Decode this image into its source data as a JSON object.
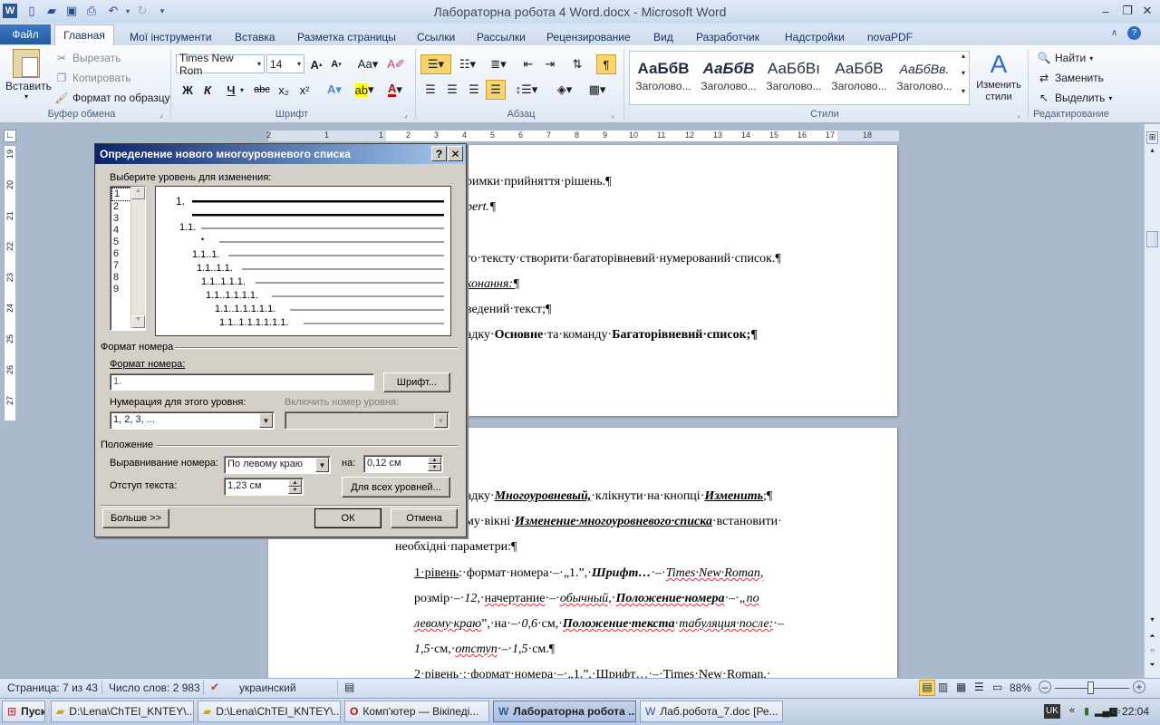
{
  "window": {
    "title": "Лабораторна робота 4 Word.docx  -  Microsoft Word"
  },
  "ribbon": {
    "tabs": [
      "Файл",
      "Главная",
      "Мої інструменти",
      "Вставка",
      "Разметка страницы",
      "Ссылки",
      "Рассылки",
      "Рецензирование",
      "Вид",
      "Разработчик",
      "Надстройки",
      "novaPDF"
    ],
    "clipboard": {
      "paste": "Вставить",
      "cut": "Вырезать",
      "copy": "Копировать",
      "format_painter": "Формат по образцу",
      "label": "Буфер обмена"
    },
    "font": {
      "name": "Times New Rom",
      "size": "14",
      "label": "Шрифт"
    },
    "paragraph": {
      "label": "Абзац"
    },
    "styles": {
      "label": "Стили",
      "items": [
        {
          "sample": "АаБбВ",
          "name": "Заголово..."
        },
        {
          "sample": "АаБбВ",
          "name": "Заголово..."
        },
        {
          "sample": "АаБбВı",
          "name": "Заголово..."
        },
        {
          "sample": "АаБбВ",
          "name": "Заголово..."
        },
        {
          "sample": "АаБбВв.",
          "name": "Заголово..."
        }
      ],
      "change": "Изменить стили"
    },
    "editing": {
      "find": "Найти",
      "replace": "Заменить",
      "select": "Выделить",
      "label": "Редактирование"
    }
  },
  "ruler": {
    "h_ticks": [
      "2",
      "1",
      "1",
      "2",
      "3",
      "4",
      "5",
      "6",
      "7",
      "8",
      "9",
      "10",
      "11",
      "12",
      "13",
      "14",
      "15",
      "16",
      "17",
      "18"
    ],
    "v_ticks": [
      "19",
      "20",
      "21",
      "22",
      "23",
      "24",
      "25",
      "26",
      "27"
    ]
  },
  "document": {
    "page1": [
      "римки·прийняття·рішень.¶",
      "pert.¶",
      "го·тексту·створити·багаторівневий·нумерований·список.¶",
      "конання:¶",
      "ведений·текст;¶"
    ],
    "page1_last": {
      "a": "адку·",
      "b": "Основне",
      "c": "·та·команду·",
      "d": "Багаторівневий·список;¶"
    },
    "page2": {
      "l1a": "адку·",
      "l1b": "Многоуровневый,",
      "l1c": "·клікнути·на·кнопці·",
      "l1d": "Изменить",
      "l1e": ";¶",
      "l2a": "му·вікні·",
      "l2b": "Изменение·многоуровневого·списка",
      "l2c": "·встановити·",
      "l3": "необхідні·параметри:¶",
      "l4a": "1·рівень",
      "l4b": ":·формат·номера·–·„1.”,·",
      "l4c": "Шрифт…",
      "l4d": "·–·",
      "l4e": "Times·New·Roman,",
      "l5a": "розмір·–·",
      "l5b": "12,",
      "l5c": "·",
      "l5d": "начертание",
      "l5e": "·–·",
      "l5f": "обычный,",
      "l5g": "·",
      "l5h": "Положение·номера",
      "l5i": "·–·",
      "l5j": "„по",
      "l6a": "левому·краю",
      "l6b": "”,·на·–·",
      "l6c": "0,6",
      "l6d": "·см,·",
      "l6e": "Положение·текста",
      "l6f": "·",
      "l6g": "табуляция·после:",
      "l6h": "·–",
      "l7a": "1,5",
      "l7b": "·см,·",
      "l7c": "отступ",
      "l7d": "·–·",
      "l7e": "1,5",
      "l7f": "·см.¶",
      "l8": "2·рівень·:·формат·номера·–·„1.”,·Шрифт…·–·Times·New·Roman,·"
    }
  },
  "dialog": {
    "title": "Определение нового многоуровневого списка",
    "help": "?",
    "close": "✕",
    "level_label": "Выберите уровень для изменения:",
    "levels": [
      "1",
      "2",
      "3",
      "4",
      "5",
      "6",
      "7",
      "8",
      "9"
    ],
    "preview": [
      "1.",
      "1.1.",
      "•",
      "1.1..1.",
      "1.1..1.1.",
      "1.1..1.1.1.",
      "1.1..1.1.1.1.",
      "1.1..1.1.1.1.1.",
      "1.1..1.1.1.1.1.1."
    ],
    "number_format_section": "Формат номера",
    "number_format_label": "Формат номера:",
    "number_format_value": "1.",
    "font_button": "Шрифт...",
    "numbering_style_label": "Нумерация для этого уровня:",
    "numbering_style_value": "1, 2, 3, ...",
    "include_level_label": "Включить номер уровня:",
    "position_section": "Положение",
    "alignment_label": "Выравнивание номера:",
    "alignment_value": "По левому краю",
    "at_label": "на:",
    "at_value": "0,12 см",
    "indent_label": "Отступ текста:",
    "indent_value": "1,23 см",
    "all_levels_button": "Для всех уровней...",
    "more_button": "Больше >>",
    "ok_button": "ОК",
    "cancel_button": "Отмена"
  },
  "status": {
    "page": "Страница: 7 из 43",
    "words": "Число слов: 2 983",
    "language": "украинский",
    "zoom": "88%"
  },
  "taskbar": {
    "start": "Пуск",
    "tasks": [
      "D:\\Lena\\ChTEI_KNTEY\\...",
      "D:\\Lena\\ChTEI_KNTEY\\...",
      "Комп'ютер — Вікіпеді...",
      "Лабораторна робота ...",
      "Лаб.робота_7.doc [Ре..."
    ],
    "lang": "UK",
    "time": "22:04"
  },
  "colors": {
    "accent": "#215a9f",
    "dialog_title": "#0a246a",
    "ribbon_bg": "#e7eef8"
  }
}
